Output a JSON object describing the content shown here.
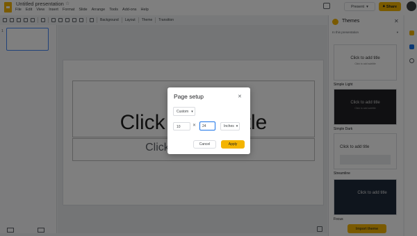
{
  "app": {
    "doc_title": "Untitled presentation",
    "menu": [
      "File",
      "Edit",
      "View",
      "Insert",
      "Format",
      "Slide",
      "Arrange",
      "Tools",
      "Add-ons",
      "Help"
    ],
    "present_label": "Present",
    "share_label": "Share",
    "accent_color": "#f4b400"
  },
  "toolbar": {
    "background_label": "Background",
    "layout_label": "Layout",
    "theme_label": "Theme",
    "transition_label": "Transition"
  },
  "filmstrip": {
    "slide_number": "1"
  },
  "slide": {
    "title": "Click to add title",
    "subtitle": "Click to add subtitle"
  },
  "themes_panel": {
    "title": "Themes",
    "section": "In this presentation",
    "cards": [
      {
        "name": "Simple Light",
        "preview_title": "Click to add title",
        "preview_sub": "Click to add subtitle",
        "bg": "#ffffff",
        "fg": "#333333"
      },
      {
        "name": "Simple Dark",
        "preview_title": "Click to add title",
        "preview_sub": "Click to add subtitle",
        "bg": "#202124",
        "fg": "#cccccc"
      },
      {
        "name": "Streamline",
        "preview_title": "Click to add title",
        "preview_sub": "",
        "bg": "#ffffff",
        "fg": "#333333"
      },
      {
        "name": "Focus",
        "preview_title": "Click to add title",
        "preview_sub": "",
        "bg": "#1e2a3a",
        "fg": "#dddddd"
      }
    ],
    "import_label": "Import theme"
  },
  "dialog": {
    "title": "Page setup",
    "size_option": "Custom",
    "width_value": "10",
    "height_value": "24",
    "unit_option": "Inches",
    "cancel_label": "Cancel",
    "apply_label": "Apply"
  }
}
